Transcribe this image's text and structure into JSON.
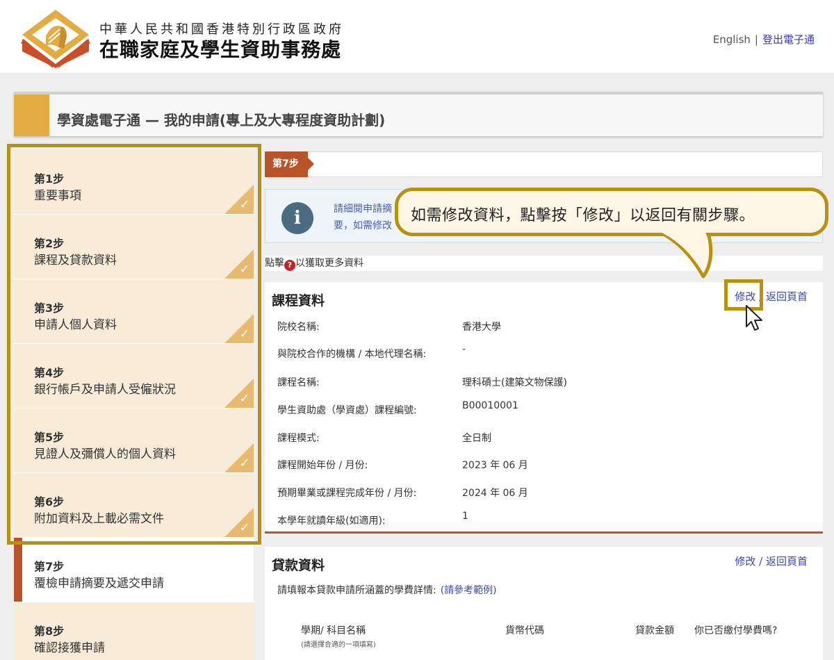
{
  "header": {
    "gov_name": "中華人民共和國香港特別行政區政府",
    "office_name": "在職家庭及學生資助事務處",
    "english_link": "English",
    "separator": "|",
    "logout_link": "登出電子通"
  },
  "page_title": "學資處電子通 — 我的申請(專上及大專程度資助計劃)",
  "steps": [
    {
      "num": "第1步",
      "label": "重要事項",
      "done": true
    },
    {
      "num": "第2步",
      "label": "課程及貸款資料",
      "done": true
    },
    {
      "num": "第3步",
      "label": "申請人個人資料",
      "done": true
    },
    {
      "num": "第4步",
      "label": "銀行帳戶及申請人受僱狀況",
      "done": true
    },
    {
      "num": "第5步",
      "label": "見證人及彌償人的個人資料",
      "done": true
    },
    {
      "num": "第6步",
      "label": "附加資料及上載必需文件",
      "done": true
    },
    {
      "num": "第7步",
      "label": "覆檢申請摘要及遞交申請",
      "done": false
    },
    {
      "num": "第8步",
      "label": "確認接獲申請",
      "done": false
    }
  ],
  "checkmark": "✓",
  "current_step": "第7步",
  "info": {
    "icon": "info-icon",
    "text": "請細閱申請摘要，如需修改資料，請點擊「修改」以返回有關步驟，以返回有關步驟。"
  },
  "help": {
    "prefix": "點擊",
    "icon_glyph": "?",
    "suffix": "以獲取更多資料"
  },
  "callout": "如需修改資料，點擊按「修改」以返回有關步驟。",
  "course_section": {
    "title": "課程資料",
    "edit": "修改",
    "slash": "/",
    "back": "返回頁首",
    "rows": [
      {
        "label": "院校名稱:",
        "value": "香港大學"
      },
      {
        "label": "與院校合作的機構 / 本地代理名稱:",
        "value": "-"
      },
      {
        "label": "課程名稱:",
        "value": "理科碩士(建築文物保護)"
      },
      {
        "label": "學生資助處（學資處）課程編號:",
        "value": "B00010001"
      },
      {
        "label": "課程模式:",
        "value": "全日制"
      },
      {
        "label": "課程開始年份 / 月份:",
        "value": "2023 年 06 月"
      },
      {
        "label": "預期畢業或課程完成年份 / 月份:",
        "value": "2024 年 06 月"
      },
      {
        "label": "本學年就讀年級(如適用):",
        "value": "1"
      }
    ]
  },
  "loan_section": {
    "title": "貸款資料",
    "edit": "修改",
    "slash": "/",
    "back": "返回頁首",
    "note": "請填報本貸款申請所涵蓋的學費詳情:",
    "note_link": "(請參考範例)",
    "columns": {
      "term": "學期/ 科目名稱",
      "term_hint": "(請選擇合適的一項填寫)",
      "currency": "貨幣代碼",
      "amount": "貸款金額",
      "paid": "你已否繳付學費嗎?"
    }
  },
  "colors": {
    "brand_gold": "#e2ac42",
    "active_step": "#b9532a",
    "highlight": "#b7920f",
    "link": "#3b4aa0"
  }
}
